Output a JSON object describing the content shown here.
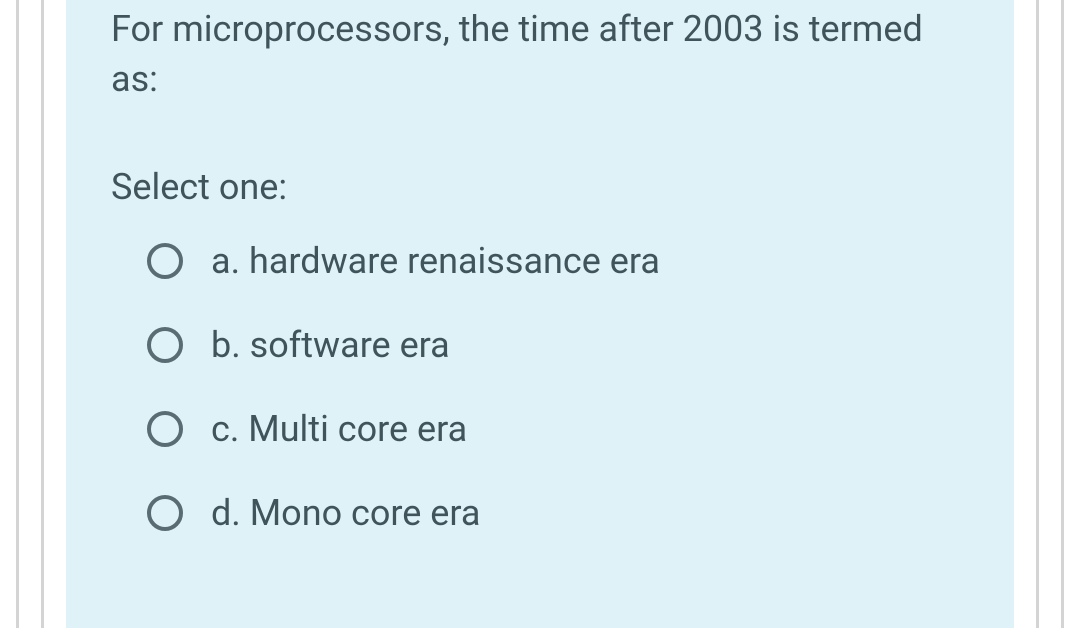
{
  "question": {
    "text": "For microprocessors, the time after 2003 is termed as:",
    "prompt": "Select one:",
    "options": [
      {
        "letter": "a.",
        "text": "hardware renaissance era"
      },
      {
        "letter": "b.",
        "text": "software era"
      },
      {
        "letter": "c.",
        "text": "Multi core era"
      },
      {
        "letter": "d.",
        "text": "Mono core era"
      }
    ]
  }
}
